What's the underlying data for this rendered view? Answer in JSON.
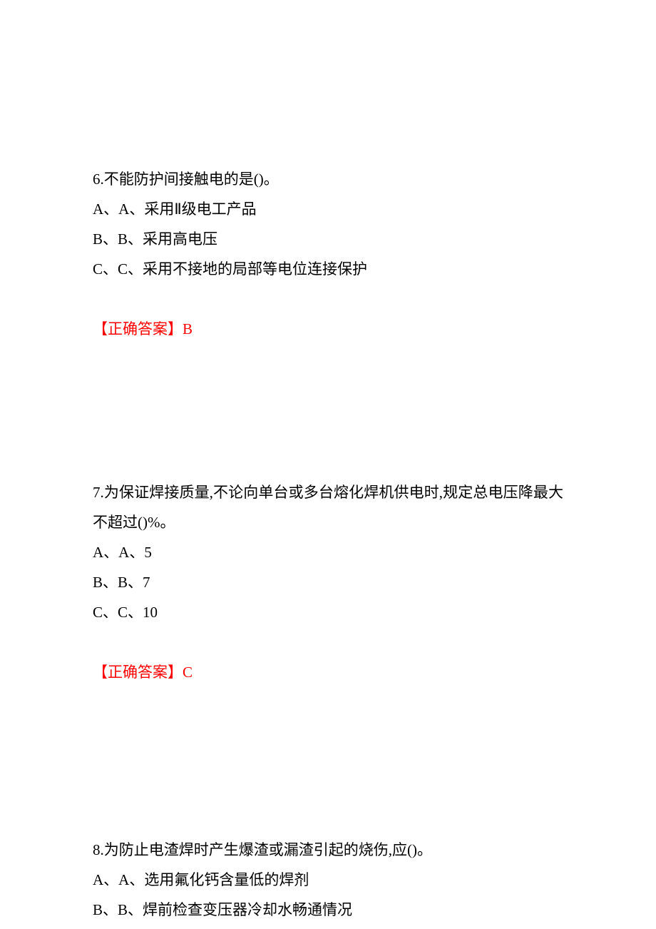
{
  "questions": [
    {
      "number": "6.",
      "stem": "不能防护间接触电的是()。",
      "options": [
        "A、A、采用Ⅱ级电工产品",
        "B、B、采用高电压",
        "C、C、采用不接地的局部等电位连接保护"
      ],
      "answer_label": "【正确答案】",
      "answer_value": "B"
    },
    {
      "number": "7.",
      "stem": "为保证焊接质量,不论向单台或多台熔化焊机供电时,规定总电压降最大不超过()%。",
      "options": [
        "A、A、5",
        "B、B、7",
        "C、C、10"
      ],
      "answer_label": "【正确答案】",
      "answer_value": "C"
    },
    {
      "number": "8.",
      "stem": "为防止电渣焊时产生爆渣或漏渣引起的烧伤,应()。",
      "options": [
        "A、A、选用氟化钙含量低的焊剂",
        "B、B、焊前检查变压器冷却水畅通情况"
      ],
      "answer_label": "",
      "answer_value": ""
    }
  ]
}
